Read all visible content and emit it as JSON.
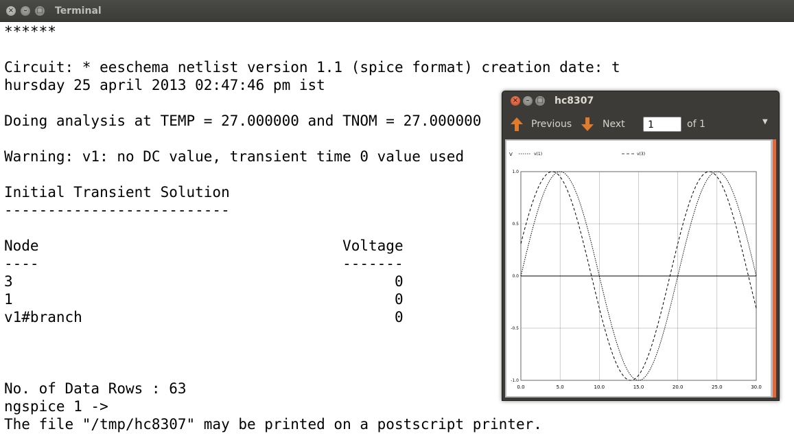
{
  "terminal": {
    "title": "Terminal",
    "lines": [
      "******",
      "",
      "Circuit: * eeschema netlist version 1.1 (spice format) creation date: t",
      "hursday 25 april 2013 02:47:46 pm ist",
      "",
      "Doing analysis at TEMP = 27.000000 and TNOM = 27.000000",
      "",
      "Warning: v1: no DC value, transient time 0 value used",
      "",
      "Initial Transient Solution",
      "--------------------------",
      "",
      "Node                                   Voltage",
      "----                                   -------",
      "3                                            0",
      "1                                            0",
      "v1#branch                                    0",
      "",
      "",
      "",
      "No. of Data Rows : 63",
      "ngspice 1 ->",
      "The file \"/tmp/hc8307\" may be printed on a postscript printer."
    ]
  },
  "viewer": {
    "title": "hc8307",
    "toolbar": {
      "previous_label": "Previous",
      "next_label": "Next",
      "page_value": "1",
      "page_of": "of 1"
    },
    "colors": {
      "arrow": "#e07b2c",
      "accent": "#e4663a"
    }
  },
  "chart_data": {
    "type": "line",
    "ylabel": "V",
    "legend_position": "top",
    "grid": true,
    "xlim": [
      0,
      30
    ],
    "ylim": [
      -1,
      1
    ],
    "x_ticks": [
      "0.0",
      "5.0",
      "10.0",
      "15.0",
      "20.0",
      "25.0",
      "30.0"
    ],
    "y_ticks": [
      "1.0",
      "0.5",
      "0.0",
      "-0.5",
      "-1.0"
    ],
    "series": [
      {
        "name": "v(1)",
        "style": "dotted",
        "period": 20,
        "phase_deg": 0,
        "amplitude": 1
      },
      {
        "name": "v(3)",
        "style": "dashed",
        "period": 20,
        "phase_deg": 18,
        "amplitude": 1
      }
    ]
  }
}
